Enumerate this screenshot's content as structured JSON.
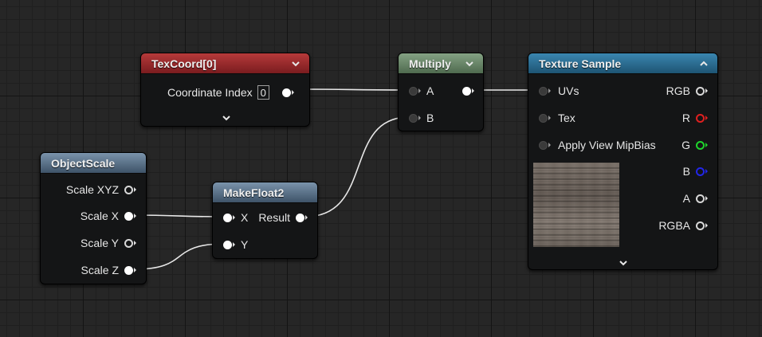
{
  "nodes": {
    "texcoord": {
      "title": "TexCoord[0]",
      "coord_label": "Coordinate Index",
      "coord_value": "0"
    },
    "multiply": {
      "title": "Multiply",
      "inputs": [
        "A",
        "B"
      ]
    },
    "texture_sample": {
      "title": "Texture Sample",
      "inputs": [
        "UVs",
        "Tex",
        "Apply View MipBias"
      ],
      "outputs": [
        "RGB",
        "R",
        "G",
        "B",
        "A",
        "RGBA"
      ]
    },
    "objectscale": {
      "title": "ObjectScale",
      "outputs": [
        "Scale XYZ",
        "Scale X",
        "Scale Y",
        "Scale Z"
      ]
    },
    "makefloat2": {
      "title": "MakeFloat2",
      "inputs": [
        "X",
        "Y"
      ],
      "output": "Result"
    }
  },
  "colors": {
    "pin_red": "#e02020",
    "pin_green": "#1fd42c",
    "pin_blue": "#2226e8",
    "wire": "#e8e8e8"
  }
}
